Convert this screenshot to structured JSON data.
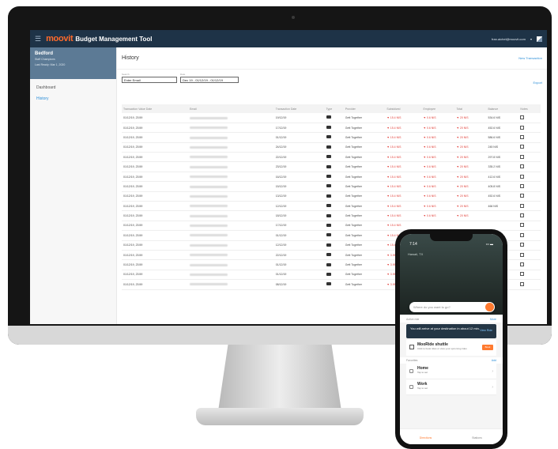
{
  "app": {
    "logo": "moovit",
    "title": "Budget Management Tool",
    "user": "fran.aichel@moovit.com"
  },
  "sidebar": {
    "account_name": "Bedford",
    "account_sub1": "Staff Champions",
    "account_sub2": "Last Ready: Mar 1, 2020",
    "items": [
      "Dashboard",
      "History"
    ]
  },
  "history": {
    "title": "History",
    "new_transaction": "New Transaction",
    "export": "Export",
    "search_label": "Search",
    "search_value": "Enter Email",
    "date_label": "Date",
    "date_value": "Dec 19 - 01/12/19 - 01/12/19"
  },
  "table": {
    "headers": [
      "Transaction Value Date",
      "Email",
      "Transaction Date",
      "Type",
      "Provider",
      "Subsidized",
      "Employee",
      "Total",
      "Balance",
      "Notes"
    ],
    "rows": [
      [
        "01/12/19, 23:59",
        "",
        "19/12/19",
        "",
        "Gett Together",
        "▼ 15.4 NIS",
        "▼ 0.6 NIS",
        "▼ 20 NIS",
        "534.6 NIS",
        ""
      ],
      [
        "01/12/19, 23:59",
        "",
        "17/12/19",
        "",
        "Gett Together",
        "▼ 15.4 NIS",
        "▼ 0.6 NIS",
        "▼ 20 NIS",
        "452.6 NIS",
        ""
      ],
      [
        "01/12/19, 23:59",
        "",
        "01/12/19",
        "",
        "Gett Together",
        "▼ 15.4 NIS",
        "▼ 0.6 NIS",
        "▼ 20 NIS",
        "586.6 NIS",
        ""
      ],
      [
        "01/12/19, 23:59",
        "",
        "24/12/19",
        "",
        "Gett Together",
        "▼ 15.4 NIS",
        "▼ 0.6 NIS",
        "▼ 20 NIS",
        "245 NIS",
        ""
      ],
      [
        "01/12/19, 23:59",
        "",
        "22/12/19",
        "",
        "Gett Together",
        "▼ 15.4 NIS",
        "▼ 0.6 NIS",
        "▼ 20 NIS",
        "297.8 NIS",
        ""
      ],
      [
        "01/12/19, 23:59",
        "",
        "23/12/19",
        "",
        "Gett Together",
        "▼ 15.4 NIS",
        "▼ 0.6 NIS",
        "▼ 20 NIS",
        "335.2 NIS",
        ""
      ],
      [
        "01/12/19, 23:59",
        "",
        "16/12/19",
        "",
        "Gett Together",
        "▼ 15.4 NIS",
        "▼ 0.6 NIS",
        "▼ 20 NIS",
        "412.6 NIS",
        ""
      ],
      [
        "01/12/19, 23:59",
        "",
        "15/12/19",
        "",
        "Gett Together",
        "▼ 15.4 NIS",
        "▼ 0.6 NIS",
        "▼ 20 NIS",
        "405.8 NIS",
        ""
      ],
      [
        "01/12/19, 23:59",
        "",
        "13/12/19",
        "",
        "Gett Together",
        "▼ 15.4 NIS",
        "▼ 0.6 NIS",
        "▼ 20 NIS",
        "452.6 NIS",
        ""
      ],
      [
        "01/12/19, 23:59",
        "",
        "12/12/19",
        "",
        "Gett Together",
        "▼ 15.4 NIS",
        "▼ 0.6 NIS",
        "▼ 20 NIS",
        "466 NIS",
        ""
      ],
      [
        "01/12/19, 23:59",
        "",
        "18/12/19",
        "",
        "Gett Together",
        "▼ 15.4 NIS",
        "▼ 0.6 NIS",
        "▼ 20 NIS",
        "",
        ""
      ],
      [
        "01/12/19, 23:59",
        "",
        "17/12/19",
        "",
        "Gett Together",
        "▼ 15.4 NIS",
        "",
        "",
        "",
        ""
      ],
      [
        "01/12/19, 23:59",
        "",
        "01/12/19",
        "",
        "Gett Together",
        "▼ 15.4 NIS",
        "",
        "",
        "",
        ""
      ],
      [
        "01/12/19, 23:59",
        "",
        "12/12/19",
        "",
        "Gett Together",
        "▼ 15.4 NIS",
        "",
        "",
        "",
        ""
      ],
      [
        "01/12/19, 23:59",
        "",
        "22/12/19",
        "",
        "Gett Together",
        "▼ 3.95 NIS",
        "",
        "",
        "",
        ""
      ],
      [
        "01/12/19, 23:59",
        "",
        "01/12/19",
        "",
        "Gett Together",
        "▼ 3.95 NIS",
        "",
        "",
        "",
        ""
      ],
      [
        "01/12/19, 23:59",
        "",
        "01/12/19",
        "",
        "Gett Together",
        "▼ 3.95 NIS",
        "",
        "",
        "",
        ""
      ],
      [
        "01/12/19, 23:59",
        "",
        "08/12/19",
        "",
        "Gett Together",
        "▼ 3.95 NIS",
        "",
        "",
        "",
        ""
      ]
    ]
  },
  "phone": {
    "time": "7:14",
    "status": "••• ▬",
    "city": "Hawaii, TX",
    "search_placeholder": "Where do you want to go?",
    "active_ride_label": "Active ride",
    "active_ride_link": "More",
    "arrival_text": "You will arrive at your destination in about 12 min.",
    "arrival_link": "View Ride",
    "shuttle_title": "MooRide shuttle",
    "shuttle_desc": "Click to book rides or view your upcoming rides",
    "shuttle_button": "Book",
    "favorites_label": "Favorites",
    "favorites_link": "Add",
    "favorites": [
      {
        "name": "Home",
        "sub": "Tap to set"
      },
      {
        "name": "Work",
        "sub": "Tap to set"
      }
    ],
    "tabs": [
      "Directions",
      "Stations"
    ]
  },
  "colors": {
    "topbar": "#1e3347",
    "accent": "#ff6a2b",
    "link": "#2e8fd8",
    "sidebar_head": "#5c7a95",
    "negative": "#e2403a"
  }
}
